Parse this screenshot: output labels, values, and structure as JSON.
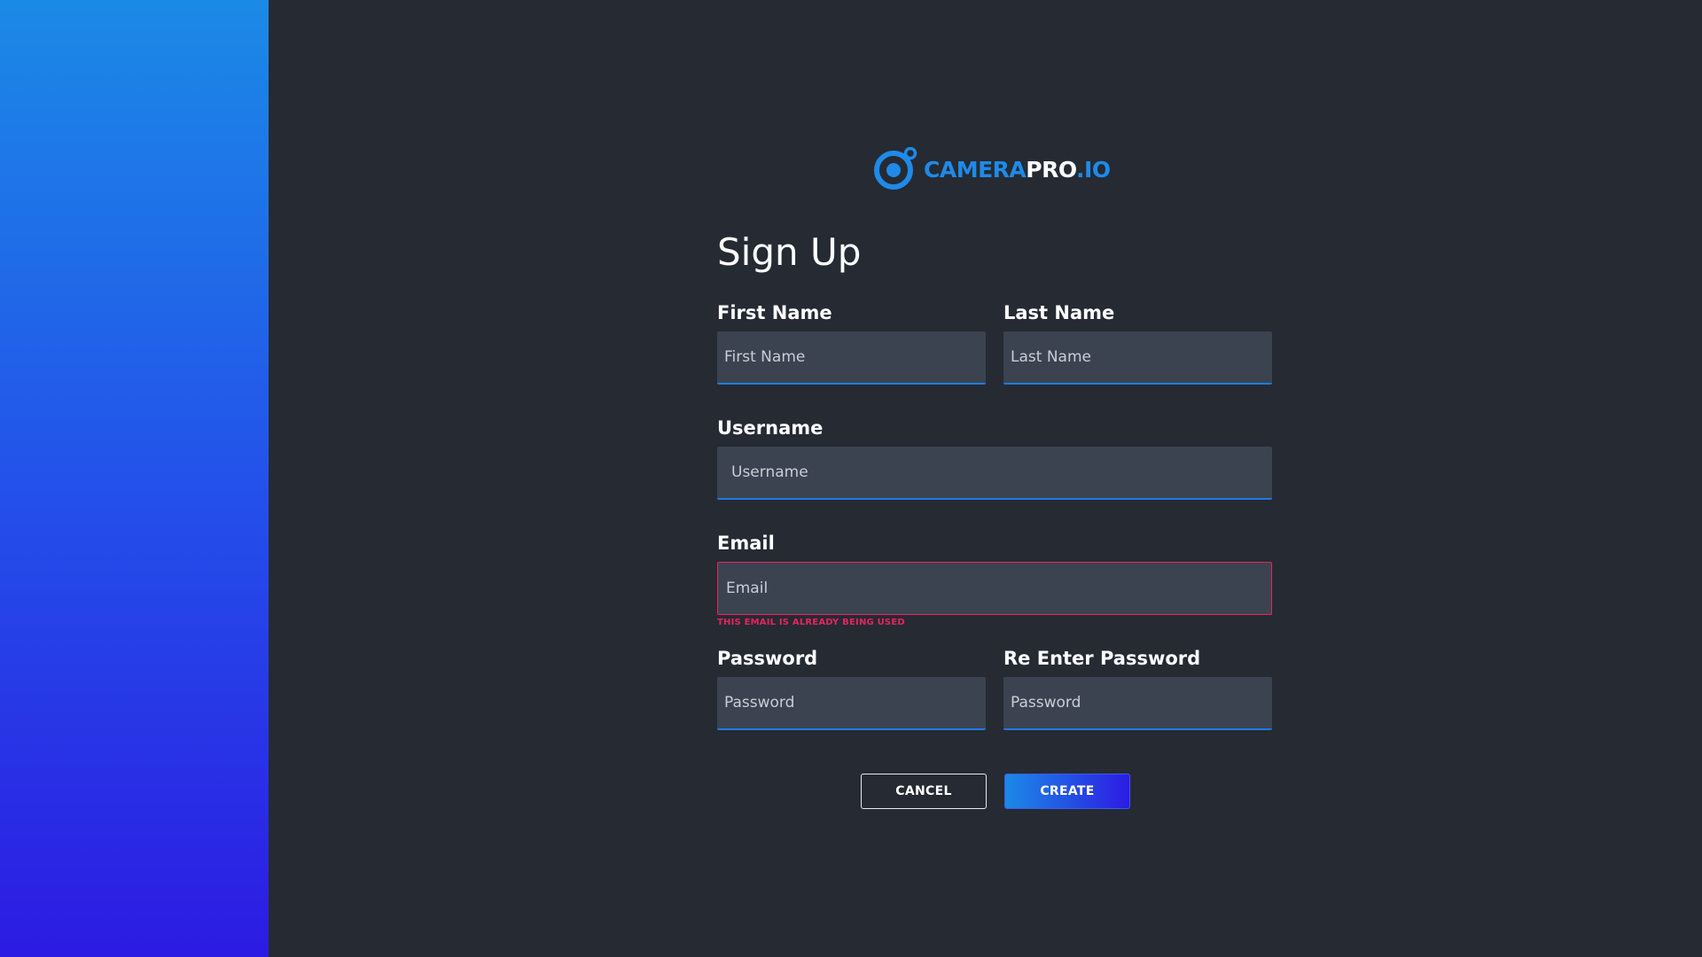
{
  "brand": {
    "name_part1": "CAMERA",
    "name_part2": "PRO",
    "name_part3": ".IO",
    "logo_icon": "camera-lens-icon"
  },
  "form": {
    "title": "Sign Up",
    "first_name": {
      "label": "First Name",
      "placeholder": "First Name",
      "value": ""
    },
    "last_name": {
      "label": "Last Name",
      "placeholder": "Last Name",
      "value": ""
    },
    "username": {
      "label": "Username",
      "placeholder": "Username",
      "value": ""
    },
    "email": {
      "label": "Email",
      "placeholder": "Email",
      "value": "",
      "error": "THIS EMAIL IS ALREADY BEING USED"
    },
    "password": {
      "label": "Password",
      "placeholder": "Password",
      "value": ""
    },
    "password_confirm": {
      "label": "Re Enter Password",
      "placeholder": "Password",
      "value": ""
    }
  },
  "actions": {
    "cancel_label": "CANCEL",
    "create_label": "CREATE"
  },
  "colors": {
    "accent": "#1f8ae8",
    "background": "#252a33",
    "input_bg": "#3b4350",
    "error": "#e8245e",
    "gradient_start": "#1b8ae6",
    "gradient_end": "#2c1be3"
  }
}
